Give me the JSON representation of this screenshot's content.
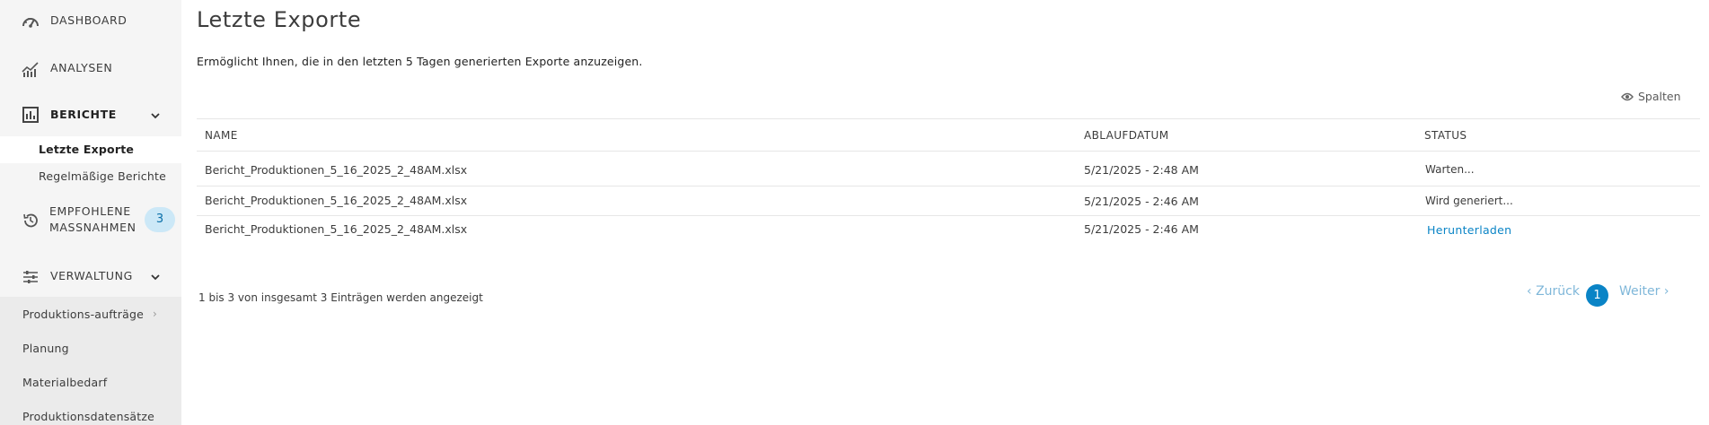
{
  "sidebar": {
    "dashboard": "DASHBOARD",
    "analysen": "ANALYSEN",
    "berichte": "BERICHTE",
    "berichte_sub": [
      "Letzte Exporte",
      "Regelmäßige Berichte"
    ],
    "empfohlene_line1": "EMPFOHLENE",
    "empfohlene_line2": "MASSNAHMEN",
    "empfohlene_badge": "3",
    "verwaltung": "VERWALTUNG",
    "verwaltung_items": [
      "Produktions-aufträge",
      "Planung",
      "Materialbedarf",
      "Produktionsdatensätze"
    ]
  },
  "main": {
    "title": "Letzte Exporte",
    "description": "Ermöglicht Ihnen, die in den letzten 5 Tagen generierten Exporte anzuzeigen.",
    "columns_button": "Spalten",
    "table": {
      "headers": [
        "NAME",
        "ABLAUFDATUM",
        "STATUS"
      ],
      "rows": [
        {
          "name": "Bericht_Produktionen_5_16_2025_2_48AM.xlsx",
          "date": "5/21/2025 - 2:48 AM",
          "status": "Warten..."
        },
        {
          "name": "Bericht_Produktionen_5_16_2025_2_48AM.xlsx",
          "date": "5/21/2025 - 2:46 AM",
          "status": "Wird generiert..."
        },
        {
          "name": "Bericht_Produktionen_5_16_2025_2_48AM.xlsx",
          "date": "5/21/2025 - 2:46 AM",
          "status": "Herunterladen"
        }
      ]
    },
    "footer_info": "1 bis 3 von insgesamt 3 Einträgen werden angezeigt",
    "pagination": {
      "prev": "Zurück",
      "page": "1",
      "next": "Weiter"
    }
  },
  "colors": {
    "accent": "#0a84c6",
    "badge_bg": "#cce8f7",
    "sidebar_bg": "#f5f5f5"
  }
}
